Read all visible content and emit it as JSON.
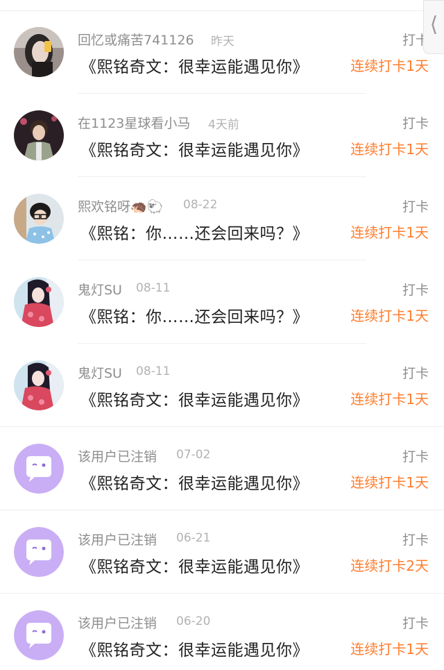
{
  "side_tab": {
    "icon": "chevron-left-icon",
    "glyph": "⟨"
  },
  "colors": {
    "accent": "#ff7d2e",
    "muted": "#8e8e8e",
    "title": "#222222",
    "deleted_avatar": "#c9aef5"
  },
  "entries": [
    {
      "username": "回忆或痛苦741126",
      "time": "昨天",
      "title": "《熙铭奇文：很幸运能遇见你》",
      "action": "打卡",
      "streak": "连续打卡1天",
      "avatar": "photo-avatar"
    },
    {
      "username": "在1123星球看小马",
      "time": "4天前",
      "title": "《熙铭奇文：很幸运能遇见你》",
      "action": "打卡",
      "streak": "连续打卡1天",
      "avatar": "photo-avatar"
    },
    {
      "username": "熙欢铭呀🦔🐑",
      "time": "08-22",
      "title": "《熙铭：你……还会回来吗？》",
      "action": "打卡",
      "streak": "连续打卡1天",
      "avatar": "photo-avatar"
    },
    {
      "username": "鬼灯SU",
      "time": "08-11",
      "title": "《熙铭：你……还会回来吗？》",
      "action": "打卡",
      "streak": "连续打卡1天",
      "avatar": "anime-avatar"
    },
    {
      "username": "鬼灯SU",
      "time": "08-11",
      "title": "《熙铭奇文：很幸运能遇见你》",
      "action": "打卡",
      "streak": "连续打卡1天",
      "avatar": "anime-avatar"
    },
    {
      "username": "该用户已注销",
      "time": "07-02",
      "title": "《熙铭奇文：很幸运能遇见你》",
      "action": "打卡",
      "streak": "连续打卡1天",
      "avatar": "deleted-user-avatar"
    },
    {
      "username": "该用户已注销",
      "time": "06-21",
      "title": "《熙铭奇文：很幸运能遇见你》",
      "action": "打卡",
      "streak": "连续打卡2天",
      "avatar": "deleted-user-avatar"
    },
    {
      "username": "该用户已注销",
      "time": "06-20",
      "title": "《熙铭奇文：很幸运能遇见你》",
      "action": "打卡",
      "streak": "连续打卡1天",
      "avatar": "deleted-user-avatar"
    }
  ]
}
